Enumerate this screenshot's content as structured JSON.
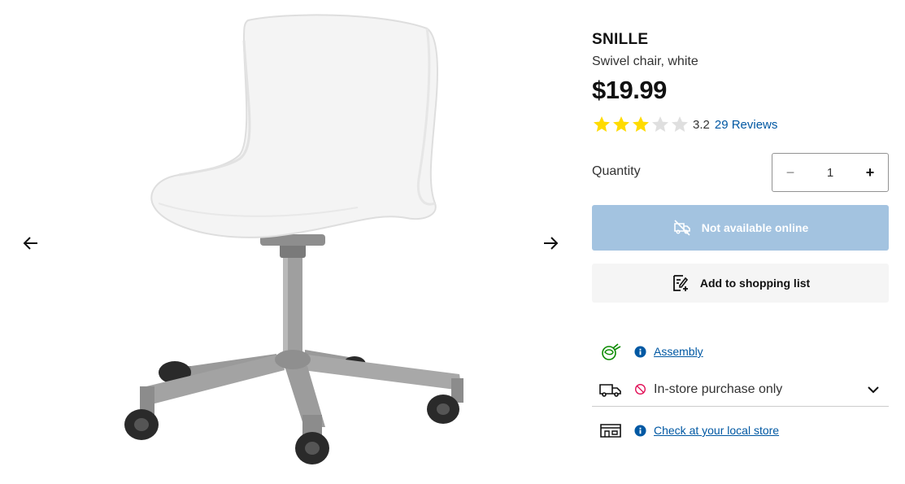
{
  "gallery": {
    "prev_icon": "arrow-left-icon",
    "next_icon": "arrow-right-icon"
  },
  "product": {
    "name": "SNILLE",
    "description": "Swivel chair, white",
    "price": "$19.99",
    "rating_value": "3.2",
    "rating_stars": 3.2,
    "rating_max": 5,
    "reviews_link": "29 Reviews",
    "star_color": "#ffdb00",
    "star_empty_color": "#dfdfdf"
  },
  "quantity": {
    "label": "Quantity",
    "value": "1",
    "minus": "−",
    "plus": "+"
  },
  "buttons": {
    "unavailable_label": "Not available online",
    "unavailable_color": "#a3c3e0",
    "shopping_list_label": "Add to shopping list"
  },
  "info": {
    "assembly_link": "Assembly",
    "instore_text": "In-store purchase only",
    "local_store_link": "Check at your local store"
  },
  "colors": {
    "link": "#0058a3",
    "info_blue": "#0058a3",
    "warning_pink": "#e00751",
    "assembly_green": "#0a8a00"
  }
}
